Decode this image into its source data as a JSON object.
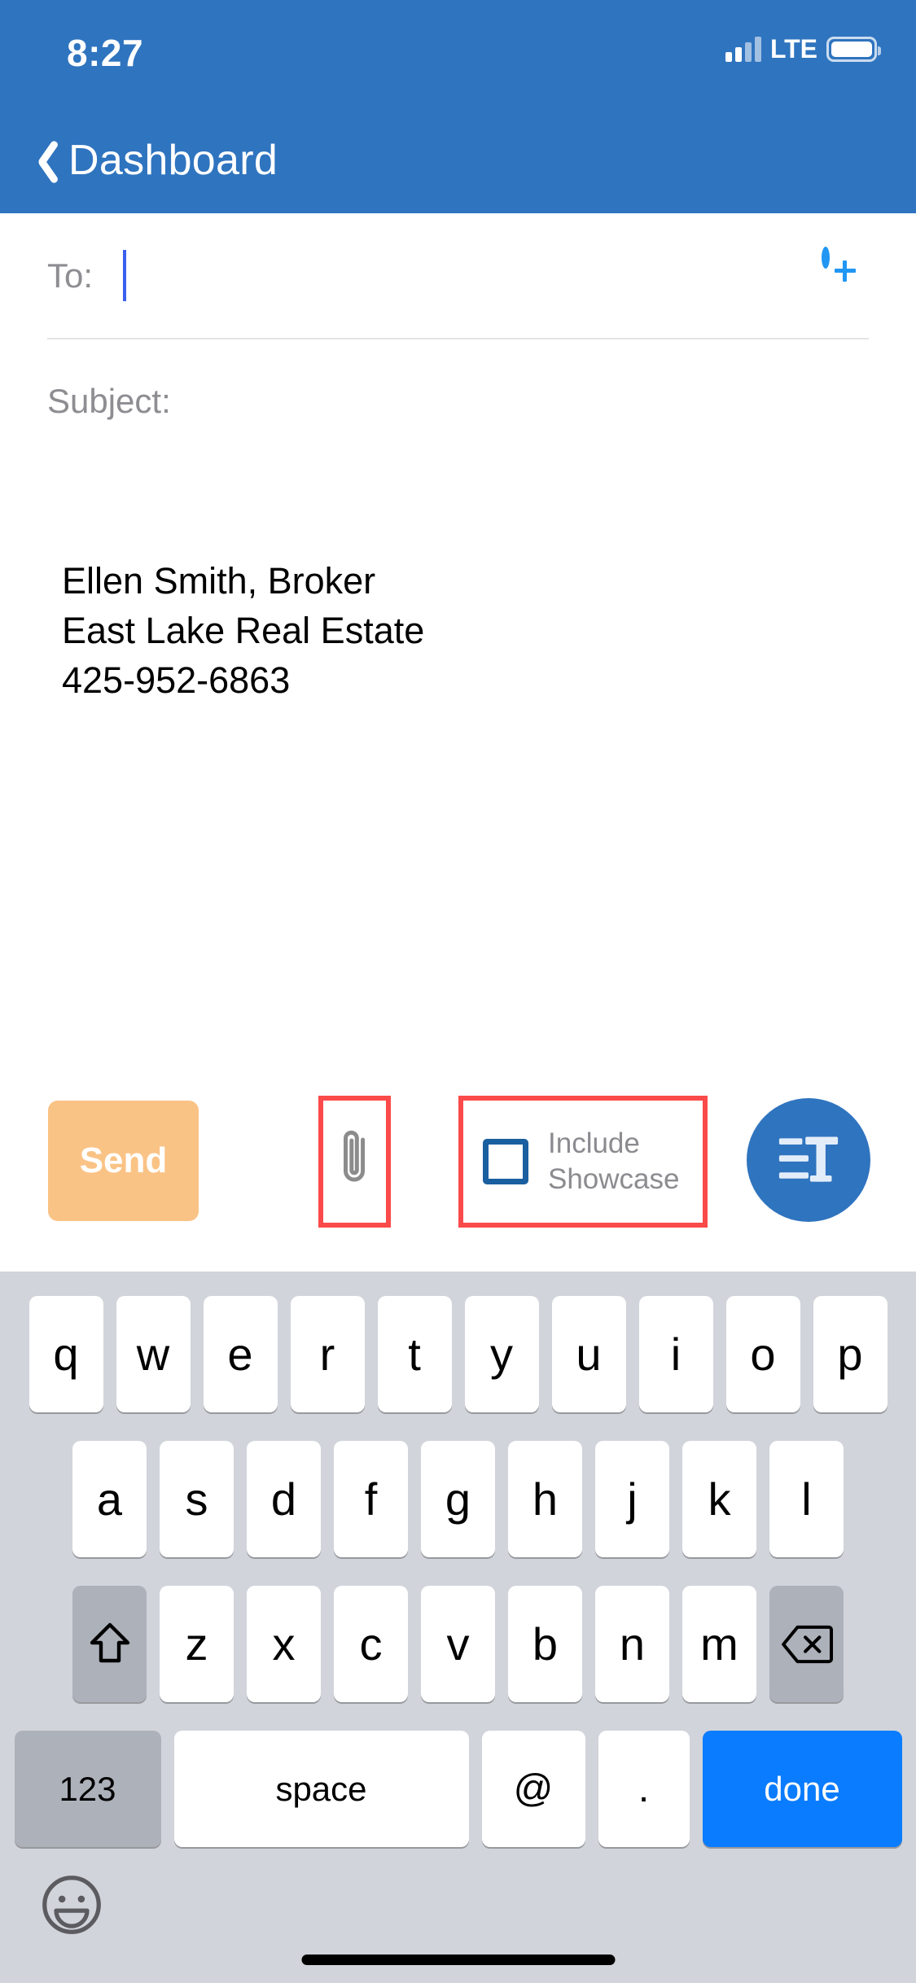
{
  "status_bar": {
    "time": "8:27",
    "network": "LTE",
    "signal_icon": "signal-bars-icon",
    "battery_icon": "battery-icon"
  },
  "nav": {
    "back_icon": "chevron-left-icon",
    "back_label": "Dashboard"
  },
  "compose": {
    "to_label": "To:",
    "to_value": "",
    "to_placeholder": "",
    "add_contact_icon": "plus-circle-icon",
    "subject_label": "Subject:",
    "subject_value": "",
    "subject_placeholder": "",
    "body_lines": [
      "Ellen Smith, Broker",
      "East Lake Real Estate",
      "425-952-6863"
    ]
  },
  "toolbar": {
    "send_label": "Send",
    "attach_icon": "paperclip-icon",
    "showcase_checkbox_checked": false,
    "showcase_label_line1": "Include",
    "showcase_label_line2": "Showcase",
    "format_icon": "text-format-icon",
    "highlight_color": "#fb4a4a",
    "send_color": "#fac386",
    "accent_color": "#2f74bf"
  },
  "keyboard": {
    "row1": [
      "q",
      "w",
      "e",
      "r",
      "t",
      "y",
      "u",
      "i",
      "o",
      "p"
    ],
    "row2": [
      "a",
      "s",
      "d",
      "f",
      "g",
      "h",
      "j",
      "k",
      "l"
    ],
    "row3": [
      "z",
      "x",
      "c",
      "v",
      "b",
      "n",
      "m"
    ],
    "shift_icon": "shift-icon",
    "backspace_icon": "backspace-icon",
    "numbers_label": "123",
    "space_label": "space",
    "at_label": "@",
    "period_label": ".",
    "done_label": "done",
    "emoji_icon": "emoji-icon"
  }
}
